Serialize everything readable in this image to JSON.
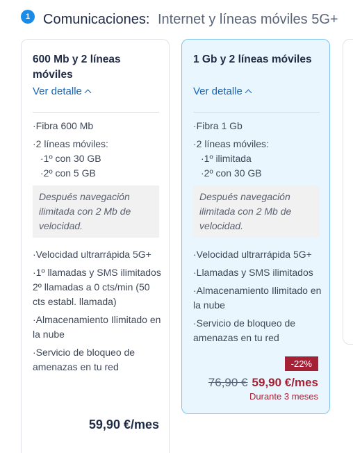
{
  "section": {
    "step": "1",
    "title": "Comunicaciones:",
    "subtitle": "Internet y líneas móviles 5G+"
  },
  "cards": [
    {
      "title": "600 Mb y 2 líneas móviles",
      "detail_link": "Ver detalle",
      "features_top": [
        "·Fibra 600 Mb",
        "·2 líneas móviles:"
      ],
      "lines": [
        "·1º con 30 GB",
        "·2º con 5 GB"
      ],
      "note": "Después navegación ilimitada con 2 Mb de velocidad.",
      "features_bottom": [
        "·Velocidad ultrarrápida 5G+",
        "·1º llamadas y SMS ilimitados 2º llamadas a 0 cts/min (50 cts establ. llamada)",
        "·Almacenamiento Ilimitado en la nube",
        "·Servicio de bloqueo de amenazas en tu red"
      ],
      "price": "59,90 €/mes"
    },
    {
      "title": "1 Gb y 2 líneas móviles",
      "detail_link": "Ver detalle",
      "features_top": [
        "·Fibra 1 Gb",
        "·2 líneas móviles:"
      ],
      "lines": [
        "·1º ilimitada",
        "·2º con 30 GB"
      ],
      "note": "Después navegación ilimitada con 2 Mb de velocidad.",
      "features_bottom": [
        "·Velocidad ultrarrápida 5G+",
        "·Llamadas y SMS ilimitados",
        "·Almacenamiento Ilimitado en la nube",
        "·Servicio de bloqueo de amenazas en tu red"
      ],
      "discount": "-22%",
      "price_old": "76,90 €",
      "price_new": "59,90 €/mes",
      "price_duration": "Durante 3 meses"
    }
  ],
  "colors": {
    "accent_blue": "#1a8ce8",
    "link": "#1565b8",
    "selected_bg": "#eaf6fd",
    "selected_border": "#7ec3ee",
    "discount": "#a52236"
  }
}
